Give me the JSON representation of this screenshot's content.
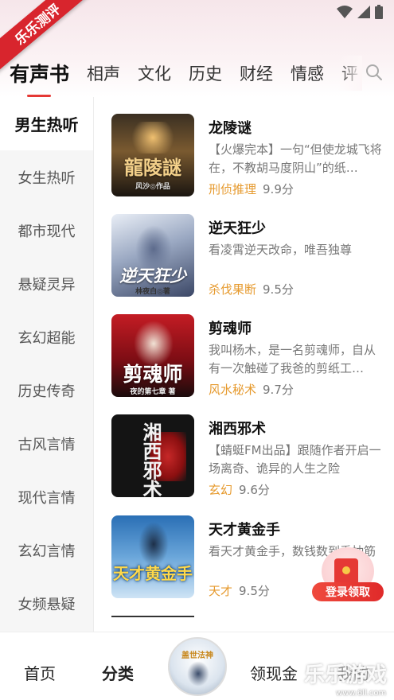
{
  "badge": {
    "text": "乐乐测评"
  },
  "tabs": [
    {
      "label": "有声书"
    },
    {
      "label": "相声"
    },
    {
      "label": "文化"
    },
    {
      "label": "历史"
    },
    {
      "label": "财经"
    },
    {
      "label": "情感"
    },
    {
      "label": "评"
    }
  ],
  "sidebar": {
    "items": [
      {
        "label": "男生热听"
      },
      {
        "label": "女生热听"
      },
      {
        "label": "都市现代"
      },
      {
        "label": "悬疑灵异"
      },
      {
        "label": "玄幻超能"
      },
      {
        "label": "历史传奇"
      },
      {
        "label": "古风言情"
      },
      {
        "label": "现代言情"
      },
      {
        "label": "玄幻言情"
      },
      {
        "label": "女频悬疑"
      }
    ]
  },
  "books": [
    {
      "title": "龙陵谜",
      "desc": "【火爆完本】一句“但使龙城飞将在，不教胡马度阴山”的纸…",
      "tag": "刑侦推理",
      "score": "9.9分",
      "cover_text": "龍陵謎",
      "cover_sub": "风沙◎作品"
    },
    {
      "title": "逆天狂少",
      "desc": "看凌霄逆天改命，唯吾独尊",
      "tag": "杀伐果断",
      "score": "9.5分",
      "cover_text": "逆天狂少",
      "cover_sub": "林夜白◎著"
    },
    {
      "title": "剪魂师",
      "desc": "我叫杨木，是一名剪魂师，自从有一次触碰了我爸的剪纸工…",
      "tag": "风水秘术",
      "score": "9.7分",
      "cover_text": "剪魂师",
      "cover_sub": "夜的第七章 著"
    },
    {
      "title": "湘西邪术",
      "desc": "【蜻蜓FM出品】跟随作者开启一场离奇、诡异的人生之险",
      "tag": "玄幻",
      "score": "9.6分",
      "cover_text": "湘西邪术",
      "cover_sub": ""
    },
    {
      "title": "天才黄金手",
      "desc": "看天才黄金手，数钱数到手抽筋",
      "tag": "天才",
      "score": "9.5分",
      "cover_text": "天才黄金手",
      "cover_sub": ""
    }
  ],
  "packet": {
    "label": "登录领取"
  },
  "bottom_nav": {
    "items": [
      {
        "label": "首页"
      },
      {
        "label": "分类"
      },
      {
        "label": "领现金"
      },
      {
        "label": "我的"
      }
    ],
    "center_text": "盖世法神"
  },
  "watermark": {
    "text": "乐乐游戏",
    "url": "www.6ll.com"
  },
  "colors": {
    "accent": "#e53935",
    "tag": "#e69a2e",
    "sidebar_bg": "#f6f6f6"
  }
}
